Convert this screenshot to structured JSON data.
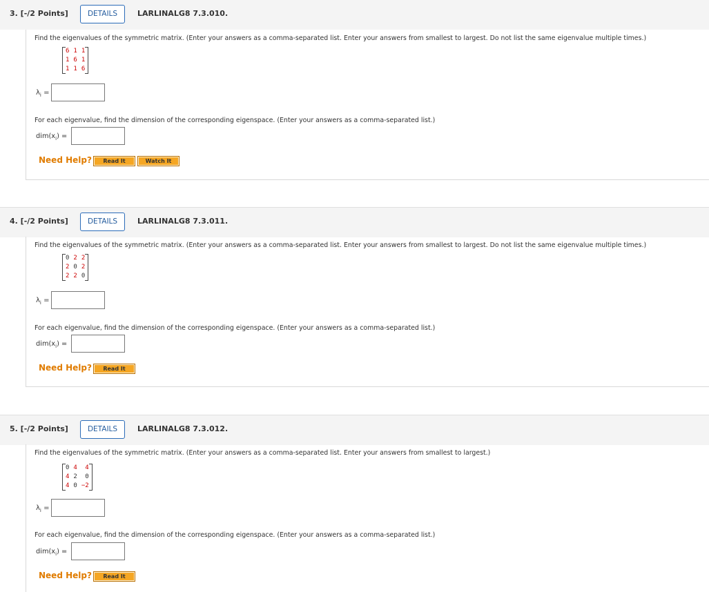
{
  "questions": [
    {
      "number": "3. [-/2 Points]",
      "details_label": "DETAILS",
      "code": "LARLINALG8 7.3.010.",
      "prompt": "Find the eigenvalues of the symmetric matrix. (Enter your answers as a comma-separated list. Enter your answers from smallest to largest. Do not list the same eigenvalue multiple times.)",
      "matrix": [
        [
          "6",
          "1",
          "1"
        ],
        [
          "1",
          "6",
          "1"
        ],
        [
          "1",
          "1",
          "6"
        ]
      ],
      "lambda_label": "λ",
      "lambda_sub": "i",
      "equals": "=",
      "eig_prompt": "For each eigenvalue, find the dimension of the corresponding eigenspace. (Enter your answers as a comma-separated list.)",
      "dim_label": "dim(x",
      "dim_sub": "i",
      "dim_close": ") =",
      "help_label": "Need Help?",
      "buttons": [
        "Read It",
        "Watch It"
      ]
    },
    {
      "number": "4. [-/2 Points]",
      "details_label": "DETAILS",
      "code": "LARLINALG8 7.3.011.",
      "prompt": "Find the eigenvalues of the symmetric matrix. (Enter your answers as a comma-separated list. Enter your answers from smallest to largest. Do not list the same eigenvalue multiple times.)",
      "matrix": [
        [
          "0",
          "2",
          "2"
        ],
        [
          "2",
          "0",
          "2"
        ],
        [
          "2",
          "2",
          "0"
        ]
      ],
      "lambda_label": "λ",
      "lambda_sub": "i",
      "equals": "=",
      "eig_prompt": "For each eigenvalue, find the dimension of the corresponding eigenspace. (Enter your answers as a comma-separated list.)",
      "dim_label": "dim(x",
      "dim_sub": "i",
      "dim_close": ") =",
      "help_label": "Need Help?",
      "buttons": [
        "Read It"
      ]
    },
    {
      "number": "5. [-/2 Points]",
      "details_label": "DETAILS",
      "code": "LARLINALG8 7.3.012.",
      "prompt": "Find the eigenvalues of the symmetric matrix. (Enter your answers as a comma-separated list. Enter your answers from smallest to largest.)",
      "matrix": [
        [
          "0",
          "4",
          "4"
        ],
        [
          "4",
          "2",
          "0"
        ],
        [
          "4",
          "0",
          "−2"
        ]
      ],
      "lambda_label": "λ",
      "lambda_sub": "i",
      "equals": "=",
      "eig_prompt": "For each eigenvalue, find the dimension of the corresponding eigenspace. (Enter your answers as a comma-separated list.)",
      "dim_label": "dim(x",
      "dim_sub": "i",
      "dim_close": ") =",
      "help_label": "Need Help?",
      "buttons": [
        "Read It"
      ]
    }
  ],
  "colors": {
    "header_bg": "#f4f4f4",
    "details_border": "#2a6bb8",
    "help_text": "#e07c00",
    "matrix_red": "#cc0000",
    "button_bg": "#f5a623"
  }
}
